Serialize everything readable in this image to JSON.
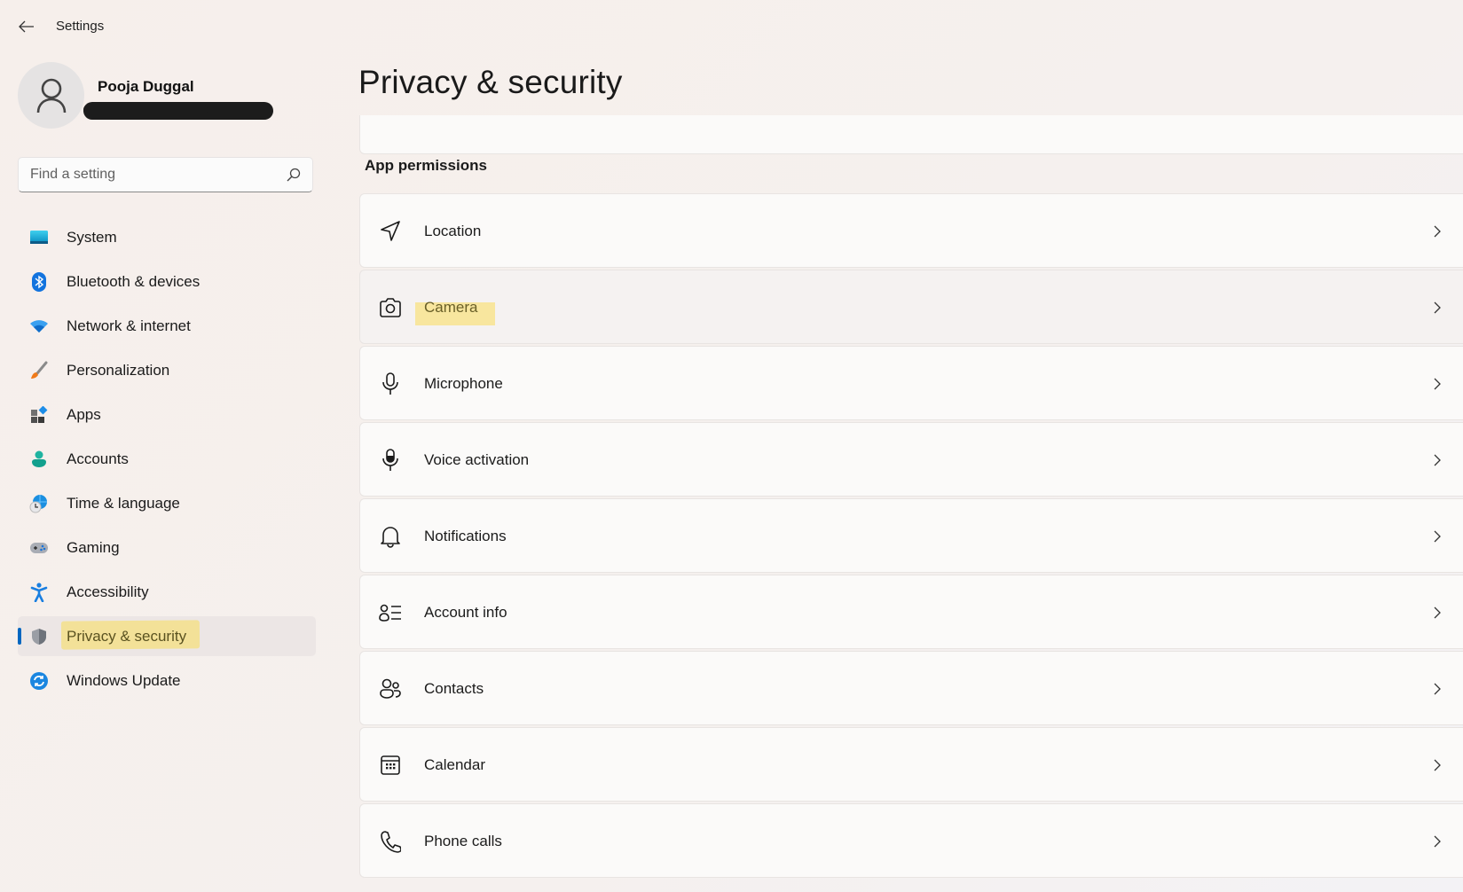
{
  "window": {
    "title": "Settings",
    "back_label": "Back"
  },
  "profile": {
    "name": "Pooja Duggal",
    "email_redacted": true
  },
  "search": {
    "placeholder": "Find a setting",
    "value": ""
  },
  "sidebar": {
    "selected": "Privacy & security",
    "accent_color": "#0067c0",
    "items": [
      {
        "label": "System",
        "icon": "system-icon"
      },
      {
        "label": "Bluetooth & devices",
        "icon": "bluetooth-icon"
      },
      {
        "label": "Network & internet",
        "icon": "wifi-icon"
      },
      {
        "label": "Personalization",
        "icon": "brush-icon"
      },
      {
        "label": "Apps",
        "icon": "apps-icon"
      },
      {
        "label": "Accounts",
        "icon": "accounts-icon"
      },
      {
        "label": "Time & language",
        "icon": "time-language-icon"
      },
      {
        "label": "Gaming",
        "icon": "gamepad-icon"
      },
      {
        "label": "Accessibility",
        "icon": "accessibility-icon"
      },
      {
        "label": "Privacy & security",
        "icon": "shield-icon",
        "highlighted": true
      },
      {
        "label": "Windows Update",
        "icon": "windows-update-icon"
      }
    ]
  },
  "main": {
    "title": "Privacy & security",
    "section_header": "App permissions",
    "items": [
      {
        "label": "Location",
        "icon": "location-icon"
      },
      {
        "label": "Camera",
        "icon": "camera-icon",
        "highlighted": true
      },
      {
        "label": "Microphone",
        "icon": "microphone-icon"
      },
      {
        "label": "Voice activation",
        "icon": "voice-activation-icon"
      },
      {
        "label": "Notifications",
        "icon": "bell-icon"
      },
      {
        "label": "Account info",
        "icon": "account-info-icon"
      },
      {
        "label": "Contacts",
        "icon": "contacts-icon"
      },
      {
        "label": "Calendar",
        "icon": "calendar-icon"
      },
      {
        "label": "Phone calls",
        "icon": "phone-icon"
      }
    ]
  }
}
